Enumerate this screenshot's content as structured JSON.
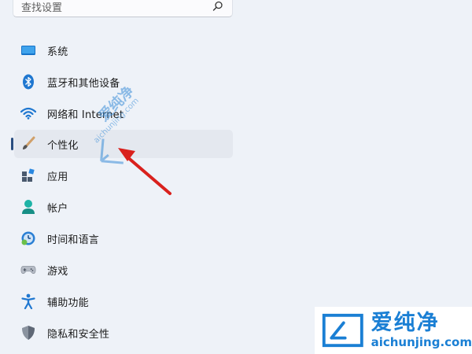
{
  "search": {
    "placeholder": "查找设置",
    "icon": "search-icon"
  },
  "nav": {
    "items": [
      {
        "label": "系统",
        "icon": "monitor-icon"
      },
      {
        "label": "蓝牙和其他设备",
        "icon": "bluetooth-icon"
      },
      {
        "label": "网络和 Internet",
        "icon": "wifi-icon"
      },
      {
        "label": "个性化",
        "icon": "brush-icon",
        "selected": true
      },
      {
        "label": "应用",
        "icon": "apps-icon"
      },
      {
        "label": "帐户",
        "icon": "account-icon"
      },
      {
        "label": "时间和语言",
        "icon": "clock-globe-icon"
      },
      {
        "label": "游戏",
        "icon": "gamepad-icon"
      },
      {
        "label": "辅助功能",
        "icon": "accessibility-icon"
      },
      {
        "label": "隐私和安全性",
        "icon": "shield-icon"
      }
    ]
  },
  "watermark": {
    "brand": "爱纯净",
    "url": "aichunjing.com"
  },
  "colors": {
    "accent": "#2a4e80",
    "arrow": "#d9211d",
    "watermark": "#1a7fd4"
  }
}
